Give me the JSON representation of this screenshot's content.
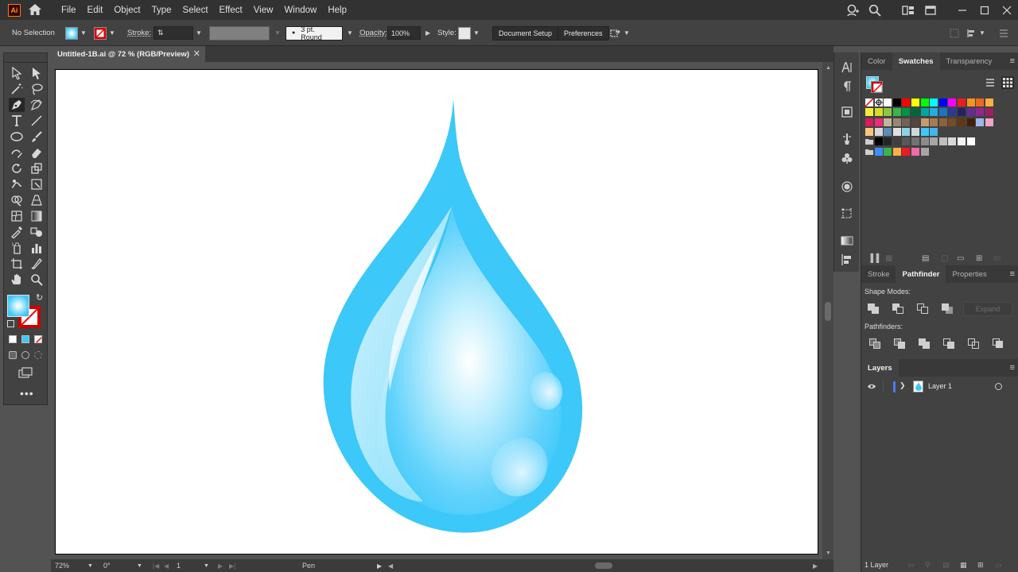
{
  "app": {
    "logo_text": "Ai"
  },
  "menu": [
    "File",
    "Edit",
    "Object",
    "Type",
    "Select",
    "Effect",
    "View",
    "Window",
    "Help"
  ],
  "control_bar": {
    "selection": "No Selection",
    "stroke_label": "Stroke:",
    "brush": "3 pt. Round",
    "opacity_label": "Opacity:",
    "opacity_value": "100%",
    "style_label": "Style:",
    "doc_setup": "Document Setup",
    "preferences": "Preferences"
  },
  "document": {
    "tab_title": "Untitled-1B.ai @ 72 % (RGB/Preview)"
  },
  "status_bar": {
    "zoom": "72%",
    "rotation": "0°",
    "artboard": "1",
    "tool": "Pen"
  },
  "panels": {
    "top_tabs": [
      "Color",
      "Swatches",
      "Transparency"
    ],
    "top_active": "Swatches",
    "mid_tabs": [
      "Stroke",
      "Pathfinder",
      "Properties"
    ],
    "mid_active": "Pathfinder",
    "shape_modes_label": "Shape Modes:",
    "pathfinders_label": "Pathfinders:",
    "expand_label": "Expand",
    "layers_tab": "Layers",
    "layer_name": "Layer 1",
    "layers_count": "1 Layer"
  },
  "colors": {
    "drop_fill": "#3cc8f8",
    "accent": "#46b4f0"
  }
}
